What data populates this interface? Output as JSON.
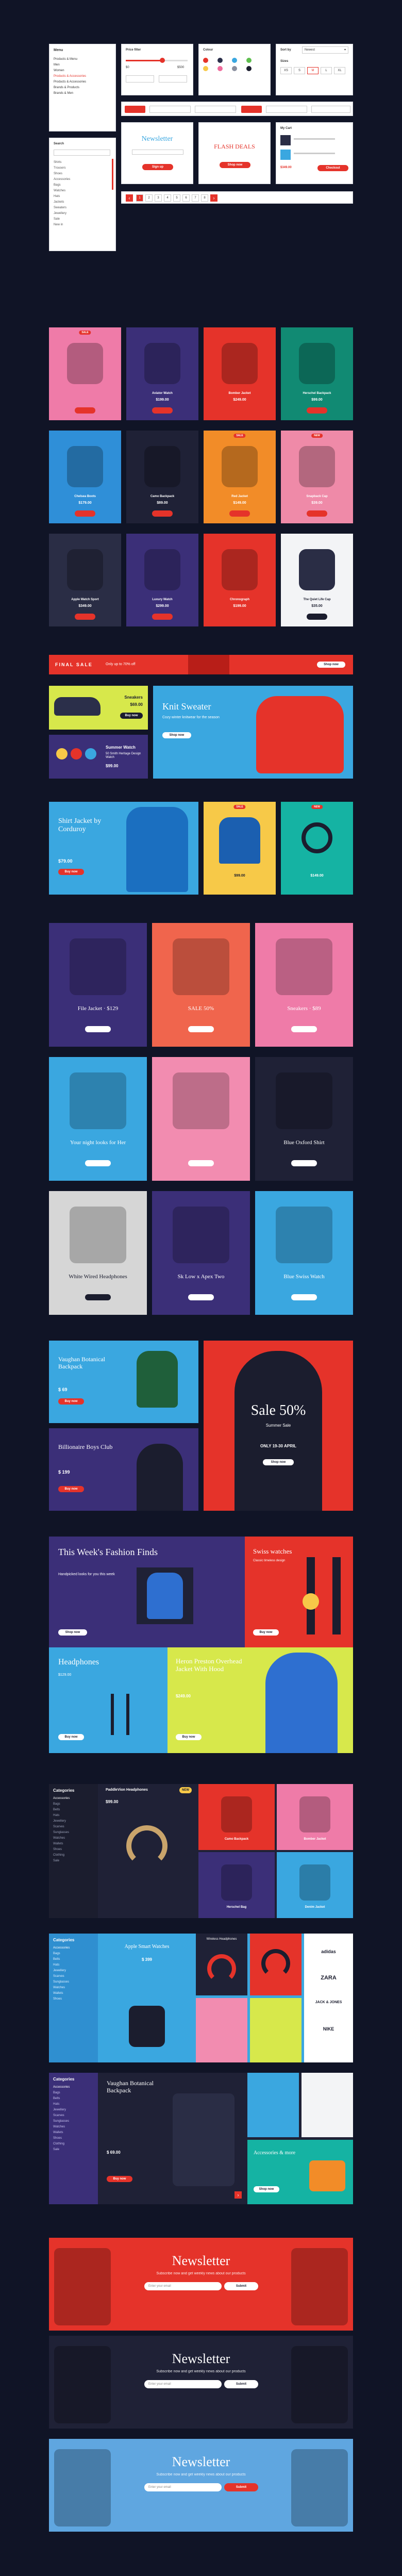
{
  "ui_kit": {
    "menu": {
      "title": "Menu",
      "items": [
        "Products & Menu",
        "Men",
        "Women",
        "Products & Accessories",
        "Products & Accessories",
        "Brands & Products",
        "Brands & Men"
      ]
    },
    "price_filter": {
      "title": "Price filter",
      "from": "$0",
      "to": "$500"
    },
    "color_filter": {
      "title": "Colour",
      "colors": [
        "#e5332a",
        "#2b2f4a",
        "#3aa7e0",
        "#5fbf4f",
        "#f7c948",
        "#ef6b9c",
        "#8a8f9e",
        "#1b1d2e"
      ]
    },
    "size_filter": {
      "title": "Sizes",
      "sizes": [
        "XS",
        "S",
        "M",
        "L",
        "XL"
      ]
    },
    "sort": {
      "label": "Sort by",
      "value": "Newest"
    },
    "pagination": {
      "pages": [
        "1",
        "2",
        "3",
        "4",
        "5",
        "6",
        "7",
        "8"
      ],
      "active": "1"
    },
    "checkbox_labels": [
      "Women",
      "Men",
      "Kids",
      "Shoes",
      "Bags",
      "Sale"
    ],
    "categories_panel": {
      "title": "Search",
      "items": [
        "Shirts",
        "Trousers",
        "Shoes",
        "Accessories",
        "Bags",
        "Watches",
        "Hats",
        "Jackets",
        "Sweaters",
        "Jewellery",
        "Sale",
        "New in"
      ]
    },
    "newsletter_widget": {
      "title": "Newsletter",
      "button": "Sign up"
    },
    "flash_widget": {
      "title": "FLASH DEALS",
      "button": "Shop now"
    },
    "cart_widget": {
      "title": "My Cart",
      "total": "$349.00",
      "button": "Checkout"
    }
  },
  "product_grid": [
    {
      "name": "",
      "price": "",
      "color": "#ef7ba8",
      "tag": "SALE"
    },
    {
      "name": "Aviator Watch",
      "price": "$199.00",
      "color": "#3b2f78",
      "tag": ""
    },
    {
      "name": "Bomber Jacket",
      "price": "$249.00",
      "color": "#e5332a",
      "tag": ""
    },
    {
      "name": "Herschel Backpack",
      "price": "$99.00",
      "color": "#118a73",
      "tag": ""
    },
    {
      "name": "Chelsea Boots",
      "price": "$179.00",
      "color": "#2f8fd8",
      "tag": ""
    },
    {
      "name": "Camo Backpack",
      "price": "$89.00",
      "color": "#1f2136",
      "tag": ""
    },
    {
      "name": "Red Jacket",
      "price": "$149.00",
      "color": "#f28c28",
      "tag": "SALE"
    },
    {
      "name": "Snapback Cap",
      "price": "$39.00",
      "color": "#ef8aa8",
      "tag": "NEW"
    },
    {
      "name": "Apple Watch Sport",
      "price": "$349.00",
      "color": "#2a2d45",
      "tag": ""
    },
    {
      "name": "Luxury Watch",
      "price": "$299.00",
      "color": "#3b2f78",
      "tag": ""
    },
    {
      "name": "Chronograph",
      "price": "$199.00",
      "color": "#e5332a",
      "tag": ""
    },
    {
      "name": "The Quiet Life Cap",
      "price": "$35.00",
      "color": "#f3f4f6",
      "tag": ""
    }
  ],
  "final_sale": {
    "title": "FINAL SALE",
    "subtitle": "Only up to 70% off",
    "button": "Shop now"
  },
  "feature_row": {
    "shoes": {
      "title": "Sneakers",
      "price": "$69.00",
      "button": "Buy now"
    },
    "knit": {
      "title": "Knit Sweater",
      "text": "Cozy winter knitwear for the season",
      "button": "Shop now"
    },
    "watches": {
      "title": "Summer Watch",
      "text": "50 Smith Heritage Design Watch",
      "price": "$99.00"
    },
    "shirt": {
      "title": "Shirt Jacket by Corduroy",
      "price": "$79.00",
      "button": "Buy now"
    },
    "jacket": {
      "price": "$99.00",
      "tag": "SALE"
    },
    "headphones": {
      "price": "$149.00",
      "tag": "NEW"
    }
  },
  "editorial_cards": [
    {
      "title": "File Jacket · $129",
      "color": "#3b2f78"
    },
    {
      "title": "SALE 50%",
      "color": "#f0654d"
    },
    {
      "title": "Sneakers · $89",
      "color": "#ef7ba8"
    },
    {
      "title": "Your night looks for Her",
      "color": "#3aa7e0"
    },
    {
      "title": "",
      "color": "#f28cb0"
    },
    {
      "title": "Blue Oxford Shirt",
      "color": "#1f2136"
    },
    {
      "title": "White Wired Headphones",
      "color": "#d6d6d6"
    },
    {
      "title": "Sk Low x Apex Two",
      "color": "#3b2f78"
    },
    {
      "title": "Blue Swiss Watch",
      "color": "#3aa7e0"
    }
  ],
  "promo_pair": {
    "backpack": {
      "title": "Vaughan Botanical Backpack",
      "price": "$ 69",
      "button": "Buy now"
    },
    "club": {
      "title": "Billionaire Boys Club",
      "price": "$ 199",
      "button": "Buy now"
    },
    "sale": {
      "title": "Sale 50%",
      "subtitle": "Summer Sale",
      "code": "ONLY 19-30 APRIL",
      "button": "Shop now"
    }
  },
  "fashion_finds": {
    "main": {
      "title": "This Week's Fashion Finds",
      "text": "Handpicked looks for you this week",
      "button": "Shop now"
    },
    "watches": {
      "title": "Swiss watches",
      "text": "Classic timeless design",
      "button": "Buy now"
    },
    "headphones": {
      "title": "Headphones",
      "price": "$129.00",
      "button": "Buy now"
    },
    "jacket": {
      "title": "Heron Preston Overhead Jacket With Hood",
      "price": "$249.00",
      "button": "Buy now"
    }
  },
  "dashboard_1": {
    "sidebar_title": "Categories",
    "items": [
      "Accessories",
      "Bags",
      "Belts",
      "Hats",
      "Jewellery",
      "Scarves",
      "Sunglasses",
      "Watches",
      "Wallets",
      "Shoes",
      "Clothing",
      "Sale"
    ],
    "product": {
      "title": "PaddleVion Headphones",
      "price": "$99.00",
      "badge": "NEW"
    },
    "cards": [
      "Camo Backpack",
      "Bomber Jacket",
      "Herschel Bag",
      "Denim Jacket"
    ]
  },
  "dashboard_2": {
    "sidebar_title": "Categories",
    "items": [
      "Accessories",
      "Bags",
      "Belts",
      "Hats",
      "Jewellery",
      "Scarves",
      "Sunglasses",
      "Watches",
      "Wallets",
      "Shoes"
    ],
    "watch": {
      "title": "Apple Smart Watches",
      "price": "$ 399"
    },
    "headphones": {
      "title": "Wireless Headphones"
    },
    "brands": [
      "adidas",
      "ZARA",
      "JACK & JONES",
      "NIKE"
    ]
  },
  "dashboard_3": {
    "sidebar_title": "Categories",
    "items": [
      "Accessories",
      "Bags",
      "Belts",
      "Hats",
      "Jewellery",
      "Scarves",
      "Sunglasses",
      "Watches",
      "Wallets",
      "Shoes",
      "Clothing",
      "Sale"
    ],
    "product": {
      "title": "Vaughan Botanical Backpack",
      "price": "$ 69.00",
      "button": "Buy now"
    },
    "side": {
      "title": "Accessories & more",
      "button": "Shop now"
    }
  },
  "newsletters": [
    {
      "title": "Newsletter",
      "text": "Subscribe now and get weekly news about our products",
      "placeholder": "Enter your email",
      "button": "Submit",
      "bg": "#e5332a"
    },
    {
      "title": "Newsletter",
      "text": "Subscribe now and get weekly news about our products",
      "placeholder": "Enter your email",
      "button": "Submit",
      "bg": "#1f2136"
    },
    {
      "title": "Newsletter",
      "text": "Subscribe now and get weekly news about our products",
      "placeholder": "Enter your email",
      "button": "Submit",
      "bg": "#5fa6e0"
    }
  ]
}
